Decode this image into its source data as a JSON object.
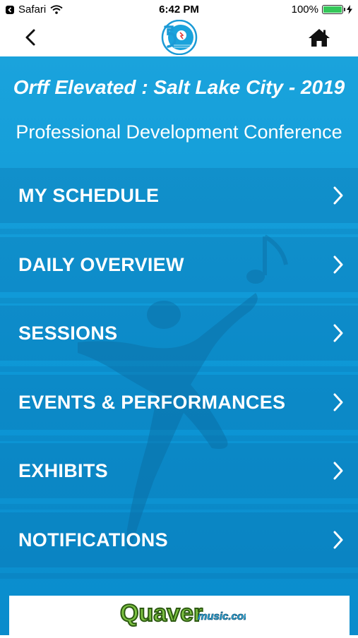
{
  "status_bar": {
    "back_app": "Safari",
    "time": "6:42 PM",
    "battery": "100%",
    "battery_level": 1.0
  },
  "nav": {
    "back_icon": "chevron-left-icon",
    "logo": "conference-logo",
    "home_icon": "home-icon"
  },
  "conference": {
    "title": "Orff Elevated : Salt Lake City - 2019",
    "subtitle": "Professional Development Conference"
  },
  "menu": [
    {
      "label": "MY SCHEDULE"
    },
    {
      "label": "DAILY OVERVIEW"
    },
    {
      "label": "SESSIONS"
    },
    {
      "label": "EVENTS & PERFORMANCES"
    },
    {
      "label": "EXHIBITS"
    },
    {
      "label": "NOTIFICATIONS"
    }
  ],
  "sponsor": {
    "logo_text": "Quaver",
    "logo_suffix": "music.com"
  },
  "colors": {
    "accent": "#1aa3dc",
    "menu_text": "#ffffff",
    "sponsor_green": "#7dc242"
  }
}
